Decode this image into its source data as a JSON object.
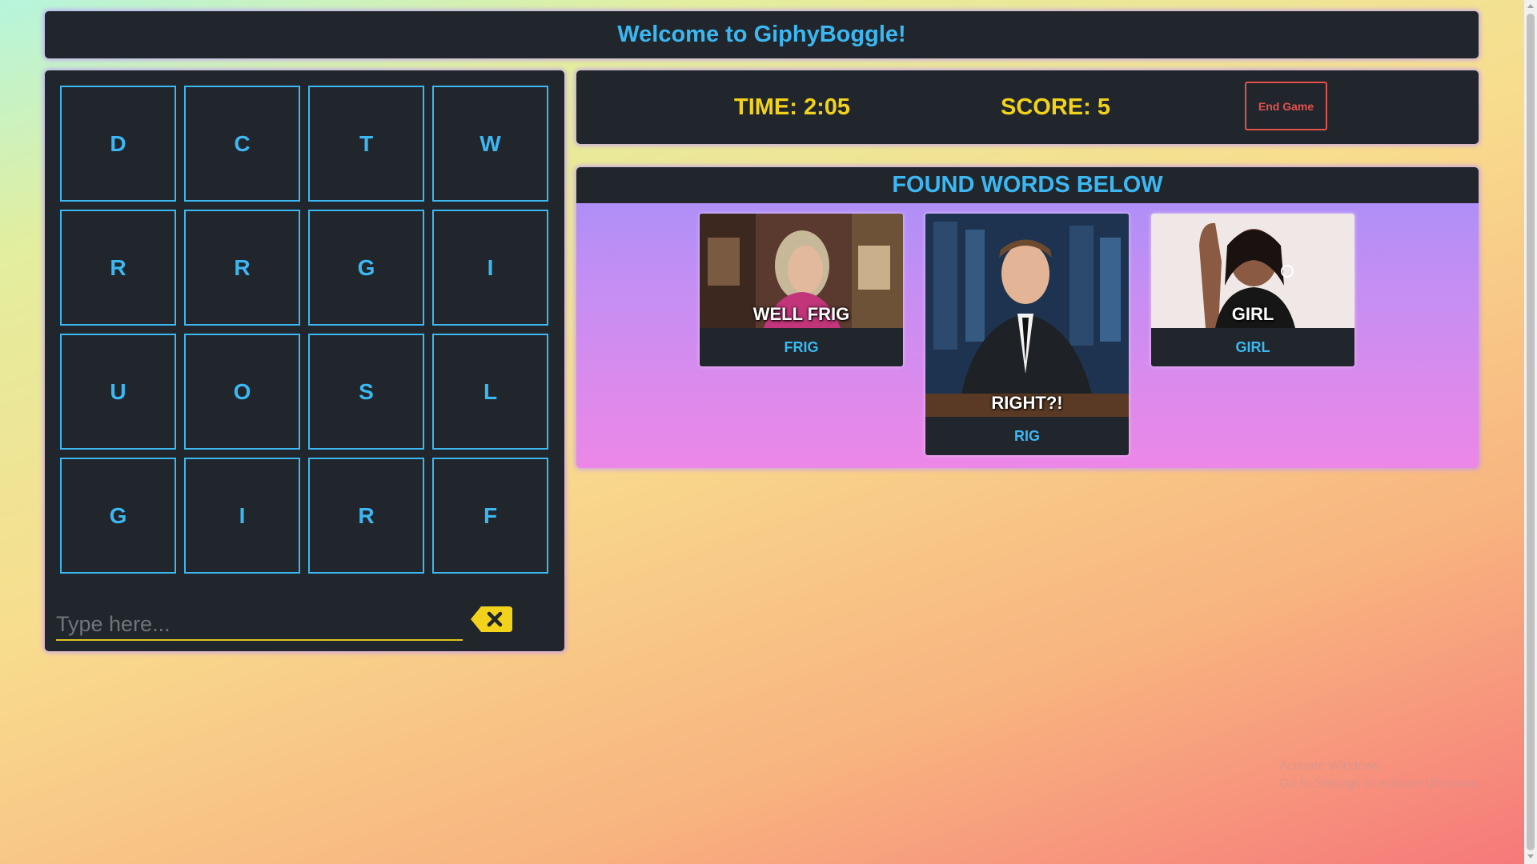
{
  "header": {
    "title": "Welcome to GiphyBoggle!"
  },
  "board": {
    "tiles": [
      "D",
      "C",
      "T",
      "W",
      "R",
      "R",
      "G",
      "I",
      "U",
      "O",
      "S",
      "L",
      "G",
      "I",
      "R",
      "F"
    ],
    "input_placeholder": "Type here...",
    "clear_icon": "backspace-icon"
  },
  "status": {
    "time": "TIME: 2:05",
    "score": "SCORE: 5",
    "end_label": "End Game"
  },
  "found": {
    "title": "FOUND WORDS BELOW",
    "words": [
      {
        "word": "FRIG",
        "caption": "WELL FRIG"
      },
      {
        "word": "RIG",
        "caption": "RIGHT?!"
      },
      {
        "word": "GIRL",
        "caption": "GIRL"
      }
    ]
  },
  "watermark": {
    "line1": "Activate Windows",
    "line2": "Go to Settings to activate Windows."
  },
  "colors": {
    "accent": "#3cb7f2",
    "highlight": "#f2d21a",
    "danger": "#e4514d",
    "panel": "#20262b"
  }
}
